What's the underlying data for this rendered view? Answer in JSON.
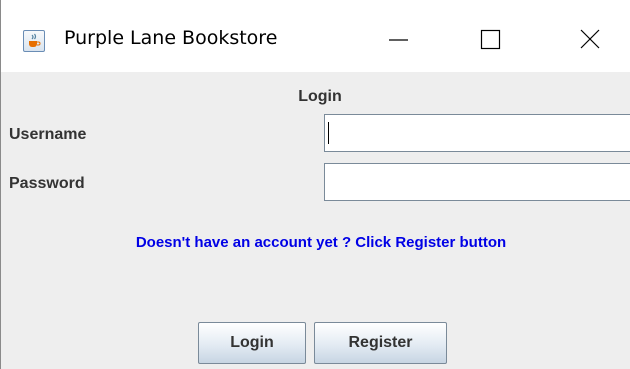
{
  "window": {
    "title": "Purple Lane Bookstore",
    "icon": "java-cup-icon",
    "controls": [
      "minimize-icon",
      "maximize-icon",
      "close-icon"
    ]
  },
  "form": {
    "heading": "Login",
    "username_label": "Username",
    "username_value": "",
    "password_label": "Password",
    "password_value": "",
    "hint": "Doesn't have an account yet ? Click Register button",
    "login_label": "Login",
    "register_label": "Register"
  },
  "colors": {
    "hint": "#0000e6",
    "panel": "#eeeeee",
    "titlebar": "#ffffff"
  }
}
